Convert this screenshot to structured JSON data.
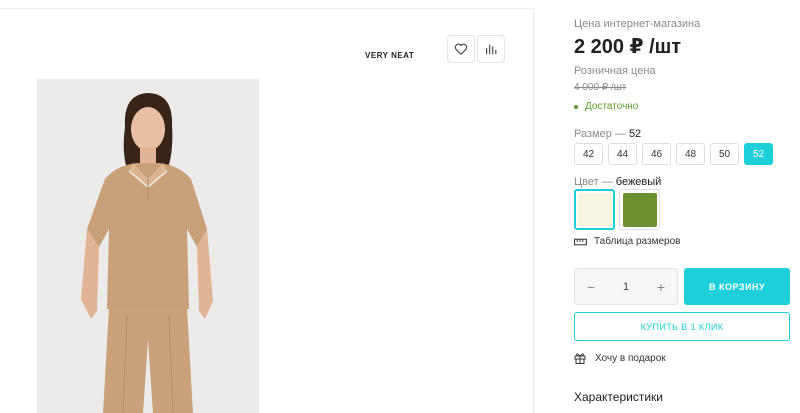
{
  "brand": "VERY NEAT",
  "icons": {
    "favorite": "heart-icon",
    "compare": "bar-chart-icon"
  },
  "price_block": {
    "online_label": "Цена интернет-магазина",
    "price": "2 200 ₽ /шт",
    "retail_label": "Розничная цена",
    "retail_price": "4 000 ₽ /шт",
    "stock": "Достаточно"
  },
  "size": {
    "label": "Размер",
    "separator": "—",
    "selected": "52",
    "options": [
      "42",
      "44",
      "46",
      "48",
      "50",
      "52"
    ]
  },
  "color": {
    "label": "Цвет",
    "separator": "—",
    "selected": "бежевый",
    "swatches": [
      "#f7f5e1",
      "#6b8f2f"
    ]
  },
  "size_table_link": "Таблица размеров",
  "quantity": {
    "minus": "−",
    "value": "1",
    "plus": "+"
  },
  "buttons": {
    "to_cart": "В КОРЗИНУ",
    "one_click": "КУПИТЬ В 1 КЛИК"
  },
  "gift_link": "Хочу в подарок",
  "specs_heading": "Характеристики",
  "colors": {
    "accent": "#1ccfd8",
    "stock": "#5a9e2f"
  }
}
